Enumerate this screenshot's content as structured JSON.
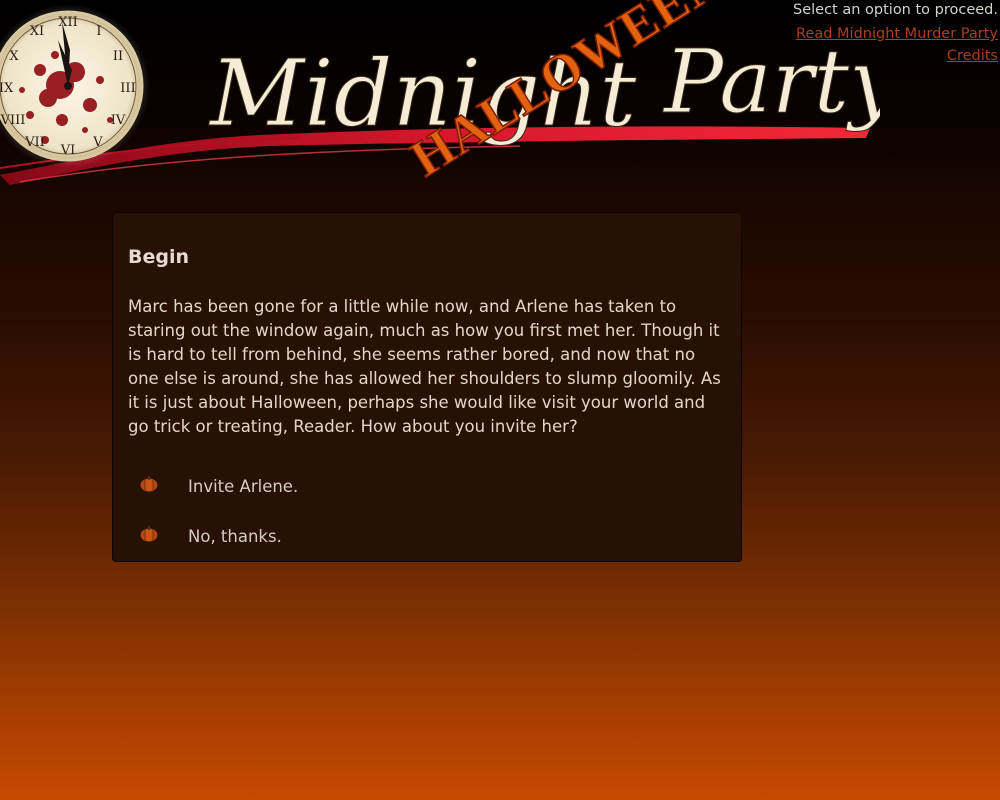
{
  "banner": {
    "title_script": "Midnight",
    "title_halloween": "HALLOWEEN",
    "title_party": "Party",
    "clock_numerals": [
      "XII",
      "I",
      "II",
      "III",
      "IV",
      "V",
      "VI",
      "VII",
      "VIII",
      "IX",
      "X",
      "XI"
    ]
  },
  "status": {
    "instruction": "Select an option to proceed.",
    "links": [
      {
        "label": "Read Midnight Murder Party"
      },
      {
        "label": "Credits"
      }
    ]
  },
  "passage": {
    "title": "Begin",
    "body": "Marc has been gone for a little while now, and Arlene has taken to staring out the window again, much as how you first met her. Though it is hard to tell from behind, she seems rather bored, and now that no one else is around, she has allowed her shoulders to slump gloomily. As it is just about Halloween, perhaps she would like visit your world and go trick or treating, Reader. How about you invite her?",
    "choices": [
      {
        "label": "Invite Arlene.",
        "icon": "pumpkin-icon"
      },
      {
        "label": "No, thanks.",
        "icon": "pumpkin-icon"
      }
    ]
  },
  "colors": {
    "background_top": "#000000",
    "background_bottom": "#c74a01",
    "panel": "#271006",
    "link": "#a8401a",
    "halloween_text": "#e0600f",
    "brush_red": "#d4142a"
  }
}
